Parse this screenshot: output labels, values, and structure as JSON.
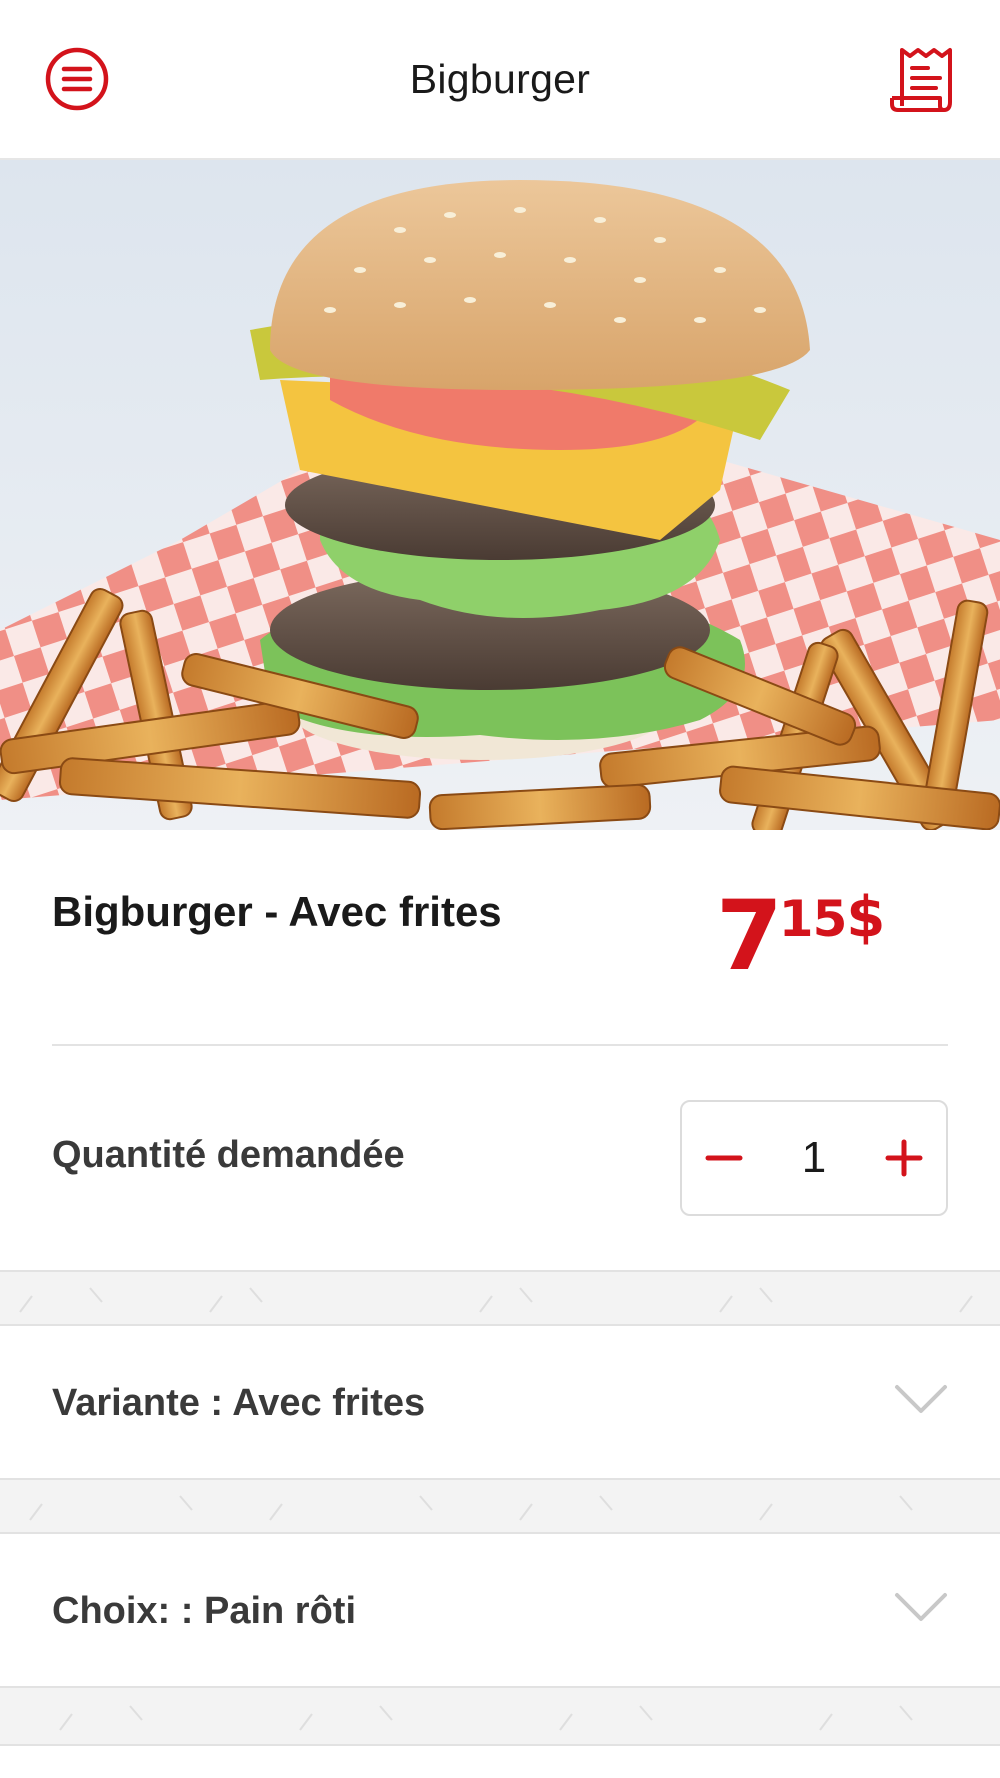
{
  "header": {
    "title": "Bigburger",
    "menu_icon": "menu-icon",
    "receipt_icon": "receipt-icon",
    "accent_color": "#d3131b"
  },
  "product": {
    "name": "Bigburger - Avec frites",
    "price_main": "7",
    "price_cents": "15",
    "price_currency": "$"
  },
  "quantity": {
    "label": "Quantité demandée",
    "value": "1",
    "minus_symbol": "−",
    "plus_symbol": "+"
  },
  "options": [
    {
      "label": "Variante : Avec frites"
    },
    {
      "label": "Choix: : Pain rôti"
    }
  ]
}
